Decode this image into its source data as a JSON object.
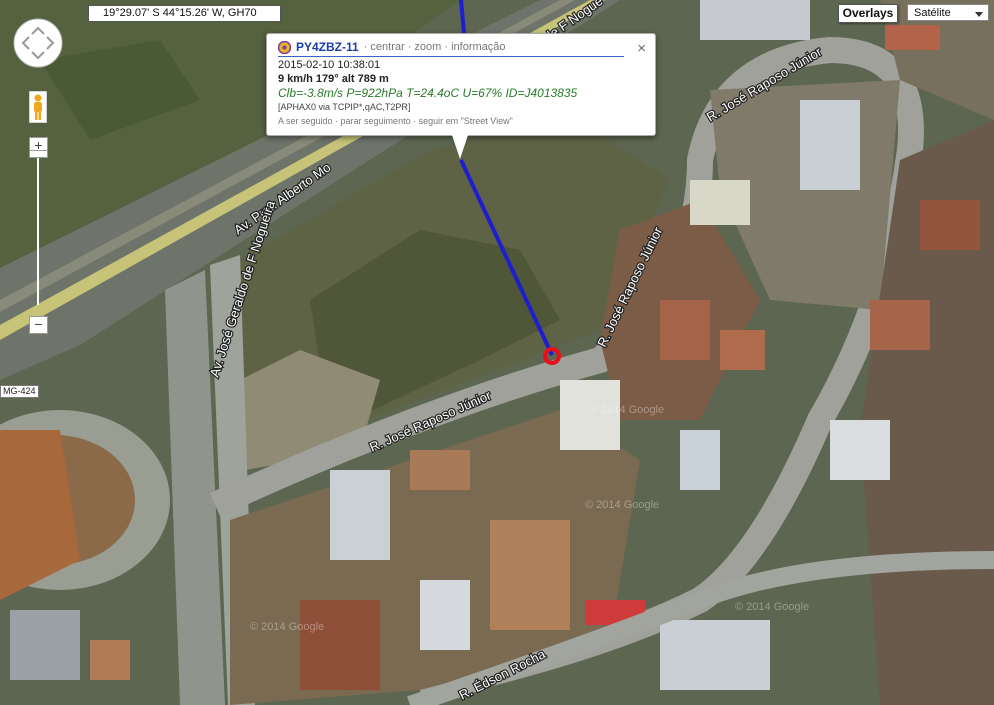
{
  "map": {
    "coordinates": "19°29.07' S 44°15.26' W, GH70",
    "overlays_label": "Overlays",
    "map_type": "Satélite",
    "road_shield": "MG-424",
    "watermarks": [
      "© 2014 Google",
      "© 2014 Google",
      "© 2014 Google",
      "© 2014 Google"
    ],
    "streets": {
      "av_alberto": "Av. Pref. Alberto Mo",
      "av_jose_geraldo": "Av. José Geraldo de F Nogueira",
      "top_f_nogue": "de F Nogue",
      "raposo_top": "R. José Raposo Júnior",
      "raposo_right": "R. José Raposo Júnior",
      "raposo_bottom": "R. José Raposo Júnior",
      "edson": "R. Édson Rocha"
    },
    "track_color": "#1e1ecf",
    "marker_color": "#e8101a"
  },
  "popup": {
    "callsign": "PY4ZBZ-11",
    "links": "· centrar · zoom · informação",
    "timestamp": "2015-02-10 10:38:01",
    "motion": "9 km/h 179° alt 789 m",
    "weather": "Clb=-3.8m/s P=922hPa T=24.4oC U=67% ID=J4013835",
    "path": "[APHAX0 via TCPIP*,qAC,T2PR]",
    "footer": "A ser seguido · parar seguimento · seguir em \"Street View\"",
    "close": "×"
  }
}
